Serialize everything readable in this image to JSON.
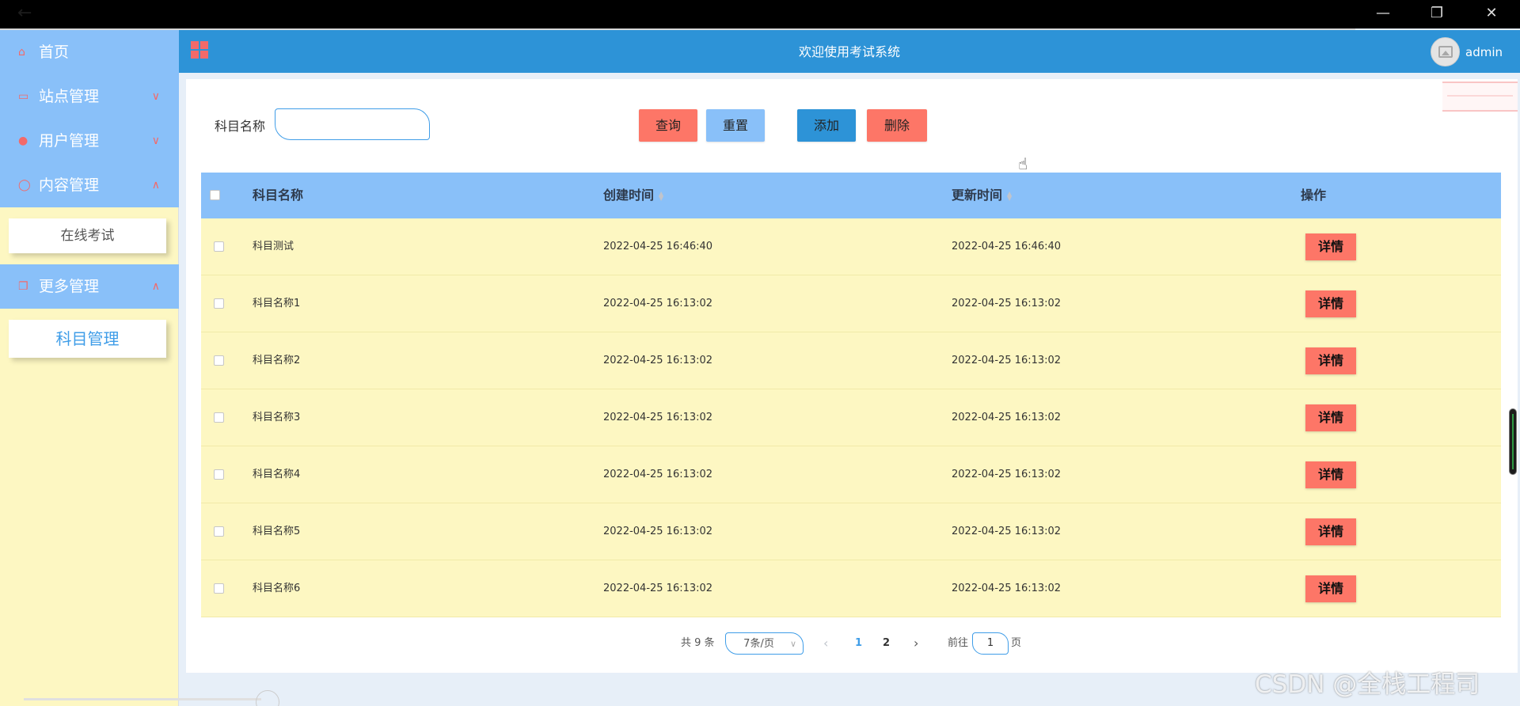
{
  "window": {
    "back": "←",
    "minimize": "—",
    "restore": "❐",
    "close": "✕"
  },
  "header": {
    "title": "欢迎使用考试系统",
    "user": "admin"
  },
  "sidebar": {
    "home": "首页",
    "site": "站点管理",
    "user": "用户管理",
    "content": "内容管理",
    "content_sub": "在线考试",
    "more": "更多管理",
    "more_sub": "科目管理"
  },
  "search": {
    "label": "科目名称",
    "value": "",
    "placeholder": ""
  },
  "buttons": {
    "query": "查询",
    "reset": "重置",
    "add": "添加",
    "delete": "删除"
  },
  "table": {
    "columns": {
      "name": "科目名称",
      "created": "创建时间",
      "updated": "更新时间",
      "actions": "操作"
    },
    "detail_label": "详情",
    "rows": [
      {
        "name": "科目测试",
        "created": "2022-04-25 16:46:40",
        "updated": "2022-04-25 16:46:40"
      },
      {
        "name": "科目名称1",
        "created": "2022-04-25 16:13:02",
        "updated": "2022-04-25 16:13:02"
      },
      {
        "name": "科目名称2",
        "created": "2022-04-25 16:13:02",
        "updated": "2022-04-25 16:13:02"
      },
      {
        "name": "科目名称3",
        "created": "2022-04-25 16:13:02",
        "updated": "2022-04-25 16:13:02"
      },
      {
        "name": "科目名称4",
        "created": "2022-04-25 16:13:02",
        "updated": "2022-04-25 16:13:02"
      },
      {
        "name": "科目名称5",
        "created": "2022-04-25 16:13:02",
        "updated": "2022-04-25 16:13:02"
      },
      {
        "name": "科目名称6",
        "created": "2022-04-25 16:13:02",
        "updated": "2022-04-25 16:13:02"
      }
    ]
  },
  "pagination": {
    "total": "共 9 条",
    "page_size": "7条/页",
    "pages": [
      "1",
      "2"
    ],
    "current": "1",
    "goto_label": "前往",
    "goto_value": "1",
    "page_suffix": "页",
    "prev": "‹",
    "next": "›"
  },
  "watermark": "CSDN @全栈工程司",
  "colors": {
    "header": "#2d93d7",
    "menu": "#89c0f9",
    "sidebar_bg": "#fdf7c2",
    "accent_red": "#fd7667",
    "table_header": "#89c0f9",
    "row_bg": "#fdf7c2"
  }
}
